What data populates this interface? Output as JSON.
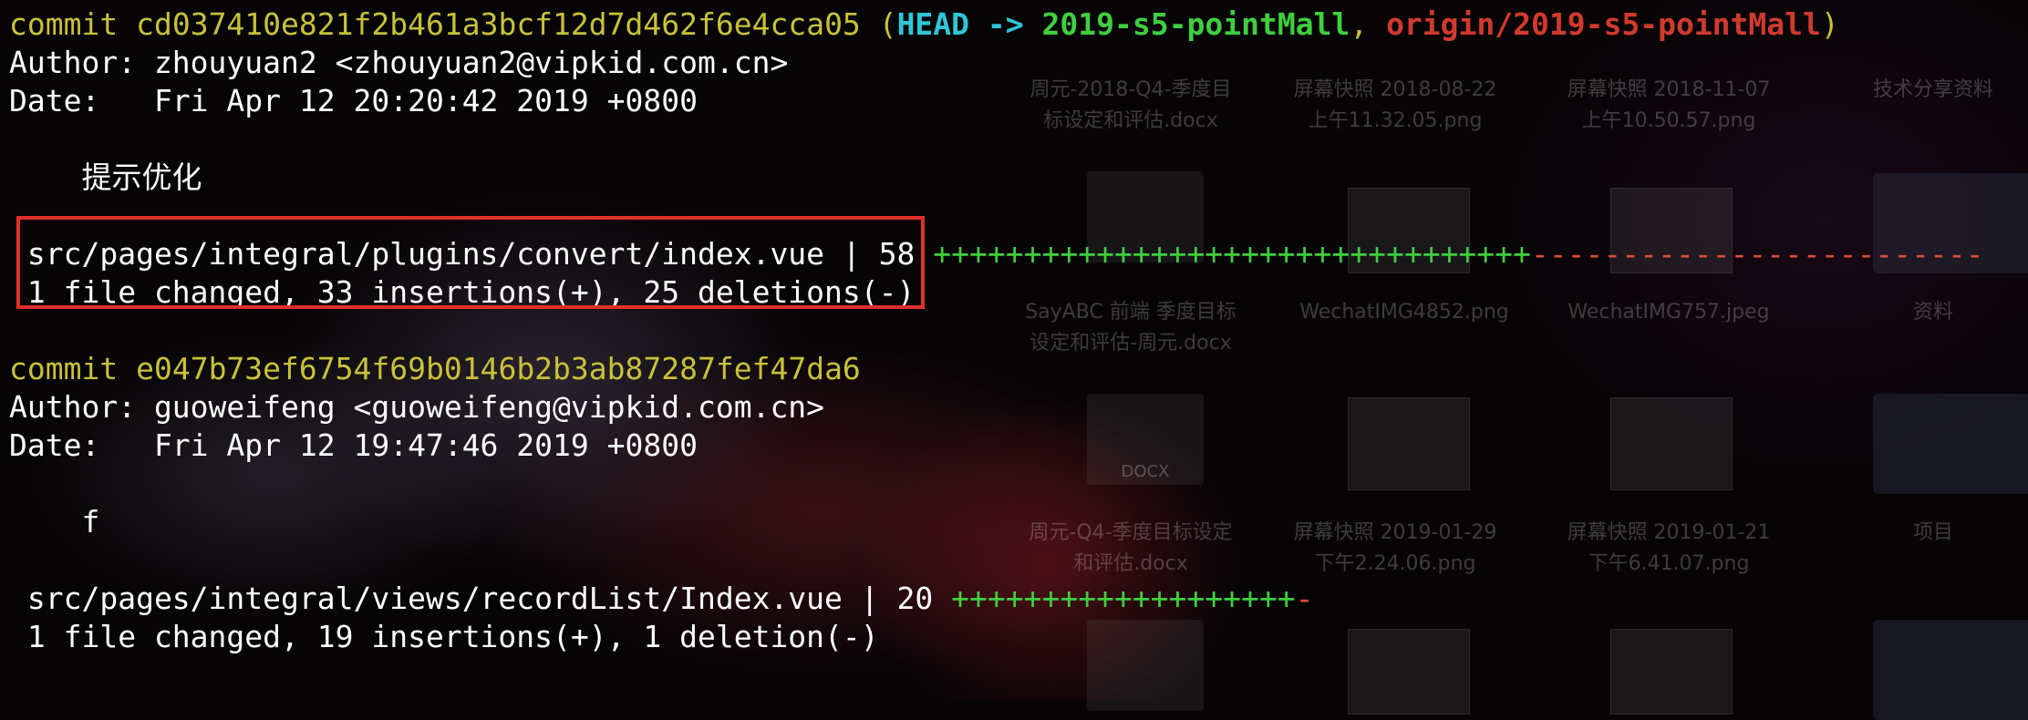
{
  "desktop": {
    "items": [
      {
        "label_line1": "周元-2018-Q4-季度目",
        "label_line2": "标设定和评估.docx"
      },
      {
        "label_line1": "屏幕快照 2018-08-22",
        "label_line2": "上午11.32.05.png"
      },
      {
        "label_line1": "屏幕快照 2018-11-07",
        "label_line2": "上午10.50.57.png"
      },
      {
        "label_line1": "技术分享资料",
        "label_line2": ""
      },
      {
        "label_line1": "SayABC 前端 季度目标",
        "label_line2": "设定和评估-周元.docx"
      },
      {
        "label_line1": "WechatIMG4852.png",
        "label_line2": ""
      },
      {
        "label_line1": "WechatIMG757.jpeg",
        "label_line2": ""
      },
      {
        "label_line1": "资料",
        "label_line2": ""
      },
      {
        "label_line1": "周元-Q4-季度目标设定",
        "label_line2": "和评估.docx"
      },
      {
        "label_line1": "屏幕快照 2019-01-29",
        "label_line2": "下午2.24.06.png"
      },
      {
        "label_line1": "屏幕快照 2019-01-21",
        "label_line2": "下午6.41.07.png"
      },
      {
        "label_line1": "项目",
        "label_line2": ""
      }
    ],
    "doc_badge": "DOCX"
  },
  "commits": [
    {
      "commit_word": "commit",
      "hash": "cd037410e821f2b461a3bcf12d7d462f6e4cca05",
      "refs": {
        "open": "(",
        "head": "HEAD",
        "arrow": "->",
        "branch": "2019-s5-pointMall",
        "sep": ",",
        "remote": "origin/2019-s5-pointMall",
        "close": ")"
      },
      "author_line": "Author: zhouyuan2 <zhouyuan2@vipkid.com.cn>",
      "date_line": "Date:   Fri Apr 12 20:20:42 2019 +0800",
      "message": "    提示优化",
      "stat_file": " src/pages/integral/plugins/convert/index.vue | 58 ",
      "stat_plus": "+++++++++++++++++++++++++++++++++",
      "stat_minus": "-------------------------",
      "summary": " 1 file changed, 33 insertions(+), 25 deletions(-)"
    },
    {
      "commit_word": "commit",
      "hash": "e047b73ef6754f69b0146b2b3ab87287fef47da6",
      "author_line": "Author: guoweifeng <guoweifeng@vipkid.com.cn>",
      "date_line": "Date:   Fri Apr 12 19:47:46 2019 +0800",
      "message": "    f",
      "stat_file": " src/pages/integral/views/recordList/Index.vue | 20 ",
      "stat_plus": "+++++++++++++++++++",
      "stat_minus": "-",
      "summary": " 1 file changed, 19 insertions(+), 1 deletion(-)"
    }
  ],
  "colors": {
    "hash": "#c8c23a",
    "head": "#2fc7d8",
    "branch": "#3fcf3f",
    "remote": "#d13a2e",
    "highlight": "#e0302a"
  }
}
